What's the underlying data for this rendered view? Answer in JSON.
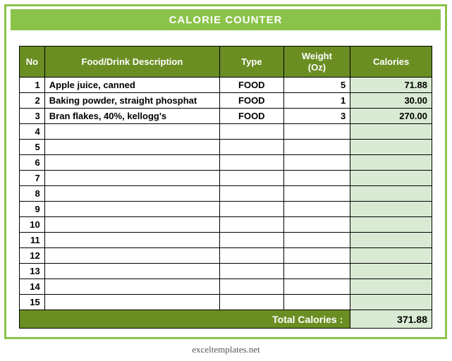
{
  "title": "CALORIE COUNTER",
  "headers": {
    "no": "No",
    "desc": "Food/Drink Description",
    "type": "Type",
    "weight_line1": "Weight",
    "weight_line2": "(Oz)",
    "calories": "Calories"
  },
  "rows": [
    {
      "no": "1",
      "desc": "Apple juice, canned",
      "type": "FOOD",
      "weight": "5",
      "calories": "71.88"
    },
    {
      "no": "2",
      "desc": "Baking powder, straight phosphat",
      "type": "FOOD",
      "weight": "1",
      "calories": "30.00"
    },
    {
      "no": "3",
      "desc": "Bran flakes, 40%, kellogg's",
      "type": "FOOD",
      "weight": "3",
      "calories": "270.00"
    },
    {
      "no": "4",
      "desc": "",
      "type": "",
      "weight": "",
      "calories": ""
    },
    {
      "no": "5",
      "desc": "",
      "type": "",
      "weight": "",
      "calories": ""
    },
    {
      "no": "6",
      "desc": "",
      "type": "",
      "weight": "",
      "calories": ""
    },
    {
      "no": "7",
      "desc": "",
      "type": "",
      "weight": "",
      "calories": ""
    },
    {
      "no": "8",
      "desc": "",
      "type": "",
      "weight": "",
      "calories": ""
    },
    {
      "no": "9",
      "desc": "",
      "type": "",
      "weight": "",
      "calories": ""
    },
    {
      "no": "10",
      "desc": "",
      "type": "",
      "weight": "",
      "calories": ""
    },
    {
      "no": "11",
      "desc": "",
      "type": "",
      "weight": "",
      "calories": ""
    },
    {
      "no": "12",
      "desc": "",
      "type": "",
      "weight": "",
      "calories": ""
    },
    {
      "no": "13",
      "desc": "",
      "type": "",
      "weight": "",
      "calories": ""
    },
    {
      "no": "14",
      "desc": "",
      "type": "",
      "weight": "",
      "calories": ""
    },
    {
      "no": "15",
      "desc": "",
      "type": "",
      "weight": "",
      "calories": ""
    }
  ],
  "total_label": "Total Calories :",
  "total_value": "371.88",
  "footer": "exceltemplates.net",
  "chart_data": {
    "type": "table",
    "title": "CALORIE COUNTER",
    "columns": [
      "No",
      "Food/Drink Description",
      "Type",
      "Weight (Oz)",
      "Calories"
    ],
    "rows": [
      [
        1,
        "Apple juice, canned",
        "FOOD",
        5,
        71.88
      ],
      [
        2,
        "Baking powder, straight phosphat",
        "FOOD",
        1,
        30.0
      ],
      [
        3,
        "Bran flakes, 40%, kellogg's",
        "FOOD",
        3,
        270.0
      ]
    ],
    "total_calories": 371.88
  }
}
